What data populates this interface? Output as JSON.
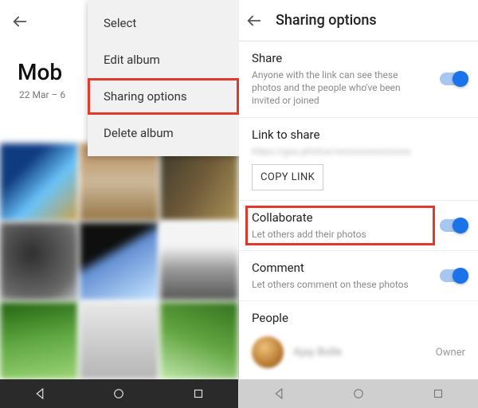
{
  "left": {
    "album_title": "Mob",
    "date_range": "22 Mar – 6",
    "menu": {
      "items": [
        {
          "label": "Select"
        },
        {
          "label": "Edit album"
        },
        {
          "label": "Sharing options"
        },
        {
          "label": "Delete album"
        }
      ],
      "highlighted_index": 2
    }
  },
  "right": {
    "header_title": "Sharing options",
    "share": {
      "title": "Share",
      "subtitle": "Anyone with the link can see these photos and the people who've been invited or joined",
      "on": true
    },
    "link": {
      "title": "Link to share",
      "url_masked": "https://goo.photos/xxxxxxxxxxxxxxxx",
      "copy_label": "COPY LINK"
    },
    "collaborate": {
      "title": "Collaborate",
      "subtitle": "Let others add their photos",
      "on": true
    },
    "comment": {
      "title": "Comment",
      "subtitle": "Let others comment on these photos",
      "on": true
    },
    "people": {
      "title": "People",
      "owner_name": "Ajay Bolle",
      "owner_role": "Owner"
    }
  },
  "colors": {
    "accent": "#1a73e8",
    "highlight": "#e03a2c"
  }
}
